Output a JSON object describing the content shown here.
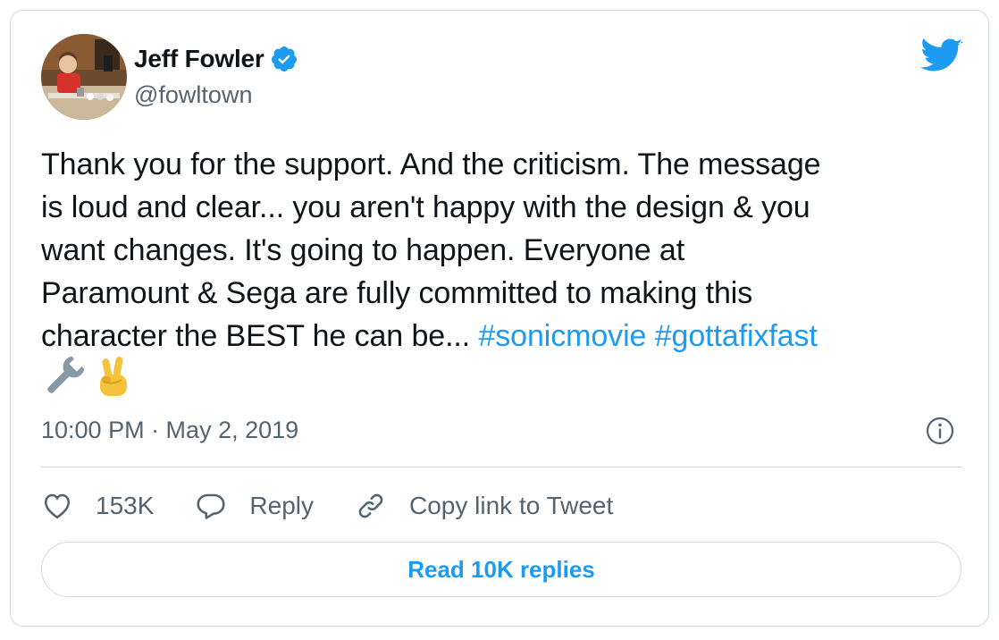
{
  "author": {
    "display_name": "Jeff Fowler",
    "handle": "@fowltown",
    "verified": true,
    "avatar_icon": "avatar-photo"
  },
  "tweet": {
    "text_lines": [
      "Thank you for the support. And the criticism. The message",
      "is loud and clear... you aren't happy with the design & you",
      "want changes. It's going to happen. Everyone at",
      "Paramount & Sega are fully committed to making this",
      "character the BEST he can be... "
    ],
    "hashtags": [
      "#sonicmovie",
      "#gottafixfast"
    ],
    "emojis": [
      "wrench-emoji",
      "victory-hand-emoji"
    ]
  },
  "timestamp": "10:00 PM · May 2, 2019",
  "actions": {
    "likes_count": "153K",
    "reply_label": "Reply",
    "copy_link_label": "Copy link to Tweet"
  },
  "read_replies_label": "Read 10K replies",
  "colors": {
    "accent": "#1d9bf0",
    "text": "#0f1419",
    "muted": "#536471",
    "border": "#cfd9de"
  }
}
